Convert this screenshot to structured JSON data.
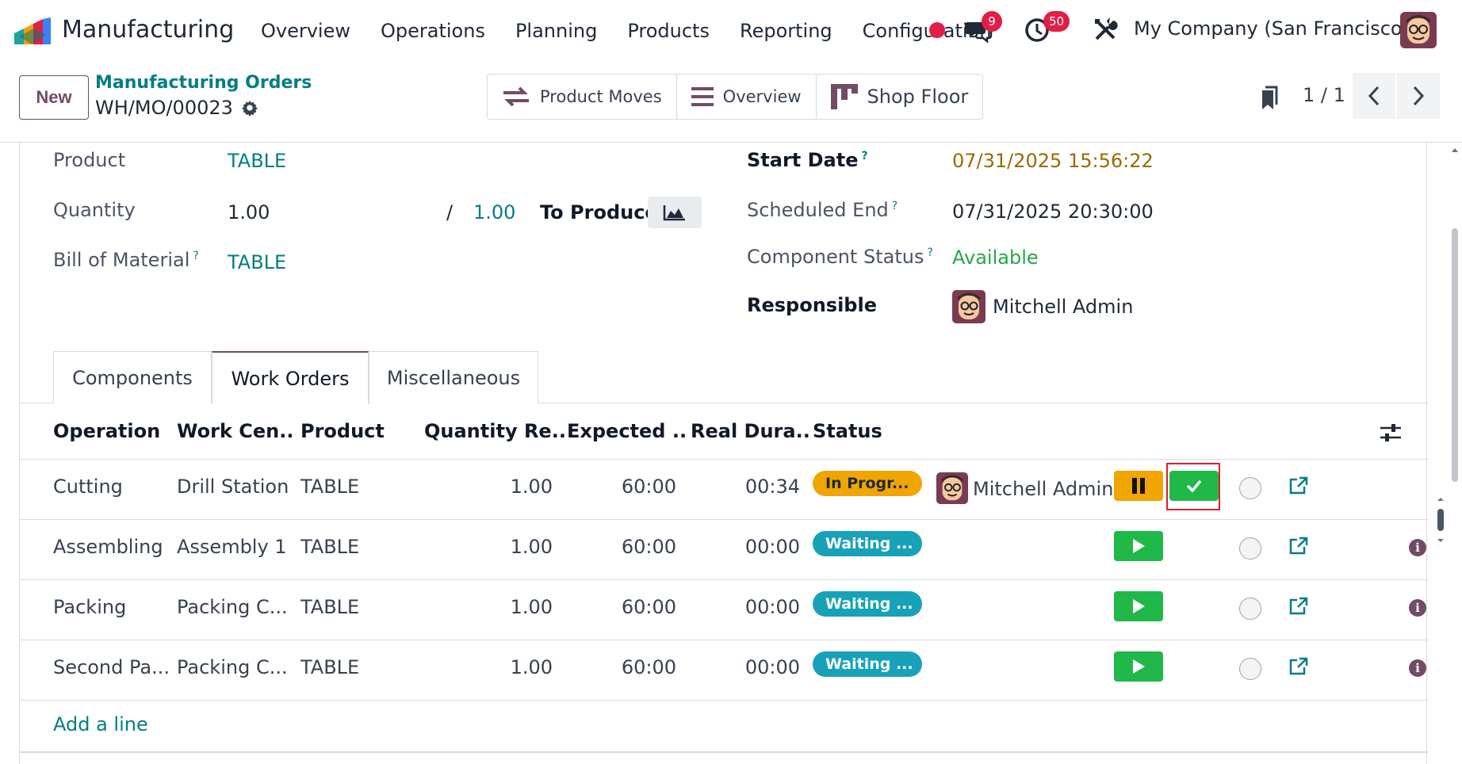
{
  "app": {
    "title": "Manufacturing"
  },
  "menu": [
    "Overview",
    "Operations",
    "Planning",
    "Products",
    "Reporting",
    "Configuration"
  ],
  "notifications": {
    "messages_count": "9",
    "activities_count": "50"
  },
  "company": "My Company (San Francisco)",
  "control": {
    "new_label": "New",
    "breadcrumb_parent": "Manufacturing Orders",
    "record_name": "WH/MO/00023",
    "smart_buttons": [
      "Product Moves",
      "Overview",
      "Shop Floor"
    ],
    "pager": "1 / 1"
  },
  "form": {
    "product_label": "Product",
    "product_value": "TABLE",
    "quantity_label": "Quantity",
    "quantity_value": "1.00",
    "quantity_slash": "/",
    "quantity_total": "1.00",
    "to_produce_label": "To Produce",
    "bom_label": "Bill of Material",
    "bom_help": "?",
    "bom_value": "TABLE",
    "start_date_label": "Start Date",
    "start_date_help": "?",
    "start_date_value": "07/31/2025 15:56:22",
    "scheduled_end_label": "Scheduled End",
    "scheduled_end_help": "?",
    "scheduled_end_value": "07/31/2025 20:30:00",
    "component_status_label": "Component Status",
    "component_status_help": "?",
    "component_status_value": "Available",
    "responsible_label": "Responsible",
    "responsible_value": "Mitchell Admin"
  },
  "tabs": [
    "Components",
    "Work Orders",
    "Miscellaneous"
  ],
  "active_tab": "Work Orders",
  "table": {
    "headers": [
      "Operation",
      "Work Cen...",
      "Product",
      "Quantity Re...",
      "Expected ...",
      "Real Dura...",
      "Status"
    ],
    "rows": [
      {
        "operation": "Cutting",
        "work_center": "Drill Station",
        "product": "TABLE",
        "quantity": "1.00",
        "expected": "60:00",
        "real": "00:34",
        "status": "In Progr...",
        "user": "Mitchell Admin"
      },
      {
        "operation": "Assembling",
        "work_center": "Assembly 1",
        "product": "TABLE",
        "quantity": "1.00",
        "expected": "60:00",
        "real": "00:00",
        "status": "Waiting ...",
        "user": ""
      },
      {
        "operation": "Packing",
        "work_center": "Packing C...",
        "product": "TABLE",
        "quantity": "1.00",
        "expected": "60:00",
        "real": "00:00",
        "status": "Waiting ...",
        "user": ""
      },
      {
        "operation": "Second Pa...",
        "work_center": "Packing C...",
        "product": "TABLE",
        "quantity": "1.00",
        "expected": "60:00",
        "real": "00:00",
        "status": "Waiting ...",
        "user": ""
      }
    ],
    "add_line": "Add a line"
  },
  "colors": {
    "brand": "#714b67",
    "link": "#017e84",
    "in_progress": "#f0a500",
    "waiting": "#17a2b8",
    "start": "#20b848",
    "badge": "#e11d48"
  },
  "icons": [
    "manufacturing-logo-icon",
    "chat-icon",
    "clock-icon",
    "tools-icon",
    "gear-icon",
    "transfer-icon",
    "list-icon",
    "shop-floor-icon",
    "bookmark-icon",
    "chevron-left-icon",
    "chevron-right-icon",
    "area-chart-icon",
    "settings-sliders-icon",
    "pause-icon",
    "check-icon",
    "play-icon",
    "external-link-icon",
    "info-icon"
  ]
}
